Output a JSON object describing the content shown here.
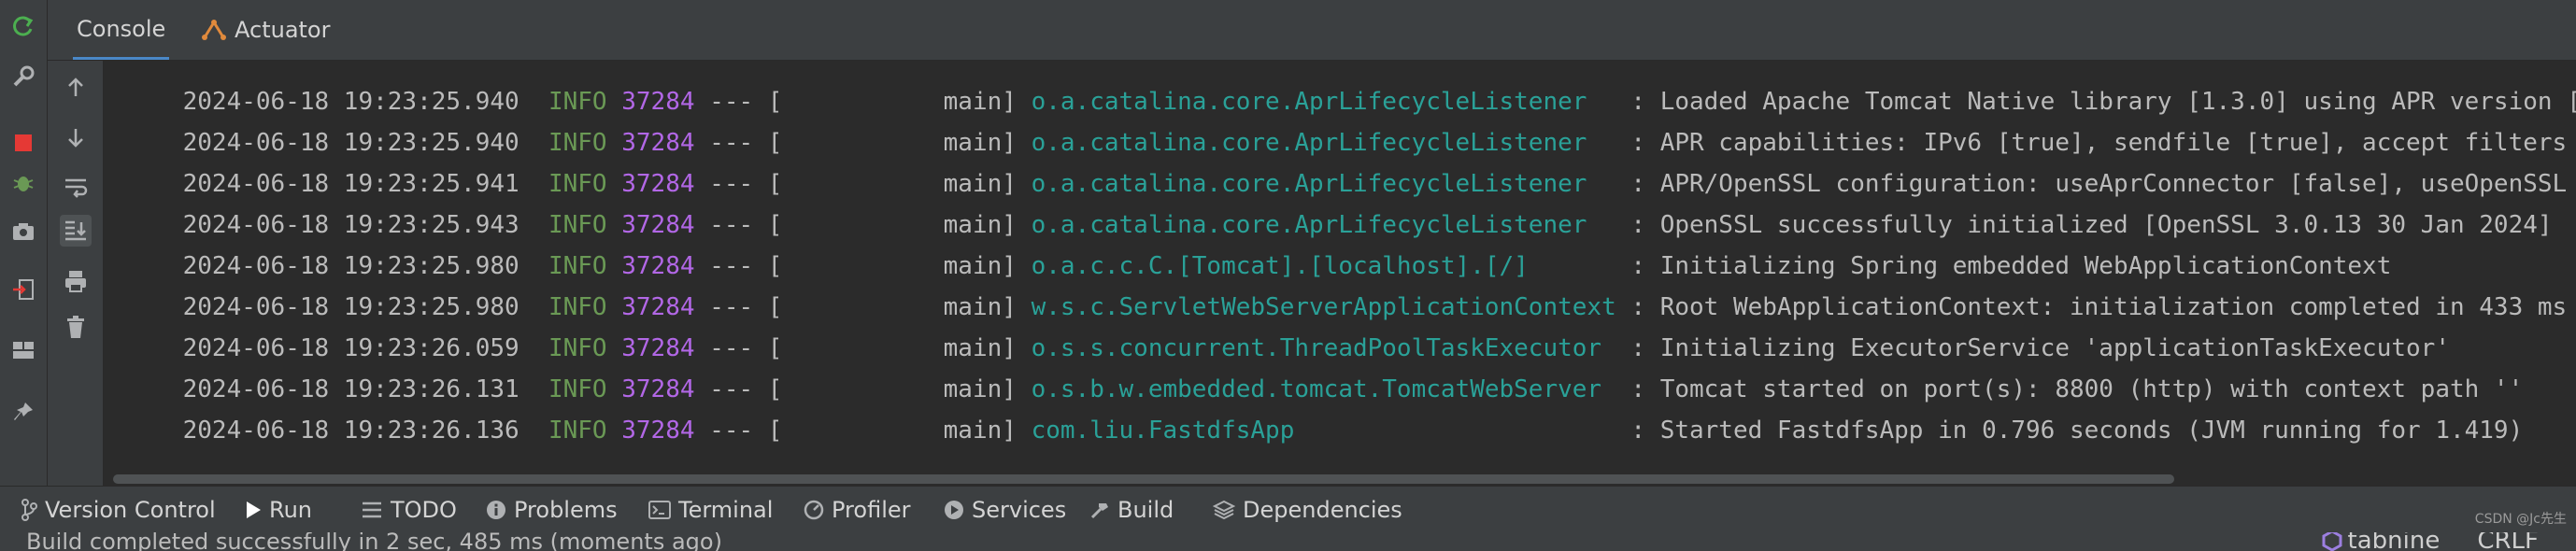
{
  "tabs": [
    {
      "label": "Console"
    },
    {
      "label": "Actuator"
    }
  ],
  "log_lines": [
    {
      "ts": "2024-06-18 19:23:25.940",
      "level": "INFO",
      "pid": "37284",
      "sep": "--- [",
      "thread": "main]",
      "logger": "o.a.catalina.core.AprLifecycleListener",
      "msg": ": Loaded Apache Tomcat Native library [1.3.0] using APR version ["
    },
    {
      "ts": "2024-06-18 19:23:25.940",
      "level": "INFO",
      "pid": "37284",
      "sep": "--- [",
      "thread": "main]",
      "logger": "o.a.catalina.core.AprLifecycleListener",
      "msg": ": APR capabilities: IPv6 [true], sendfile [true], accept filters"
    },
    {
      "ts": "2024-06-18 19:23:25.941",
      "level": "INFO",
      "pid": "37284",
      "sep": "--- [",
      "thread": "main]",
      "logger": "o.a.catalina.core.AprLifecycleListener",
      "msg": ": APR/OpenSSL configuration: useAprConnector [false], useOpenSSL"
    },
    {
      "ts": "2024-06-18 19:23:25.943",
      "level": "INFO",
      "pid": "37284",
      "sep": "--- [",
      "thread": "main]",
      "logger": "o.a.catalina.core.AprLifecycleListener",
      "msg": ": OpenSSL successfully initialized [OpenSSL 3.0.13 30 Jan 2024]"
    },
    {
      "ts": "2024-06-18 19:23:25.980",
      "level": "INFO",
      "pid": "37284",
      "sep": "--- [",
      "thread": "main]",
      "logger": "o.a.c.c.C.[Tomcat].[localhost].[/]",
      "msg": ": Initializing Spring embedded WebApplicationContext"
    },
    {
      "ts": "2024-06-18 19:23:25.980",
      "level": "INFO",
      "pid": "37284",
      "sep": "--- [",
      "thread": "main]",
      "logger": "w.s.c.ServletWebServerApplicationContext",
      "msg": ": Root WebApplicationContext: initialization completed in 433 ms"
    },
    {
      "ts": "2024-06-18 19:23:26.059",
      "level": "INFO",
      "pid": "37284",
      "sep": "--- [",
      "thread": "main]",
      "logger": "o.s.s.concurrent.ThreadPoolTaskExecutor",
      "msg": ": Initializing ExecutorService 'applicationTaskExecutor'"
    },
    {
      "ts": "2024-06-18 19:23:26.131",
      "level": "INFO",
      "pid": "37284",
      "sep": "--- [",
      "thread": "main]",
      "logger": "o.s.b.w.embedded.tomcat.TomcatWebServer",
      "msg": ": Tomcat started on port(s): 8800 (http) with context path ''"
    },
    {
      "ts": "2024-06-18 19:23:26.136",
      "level": "INFO",
      "pid": "37284",
      "sep": "--- [",
      "thread": "main]",
      "logger": "com.liu.FastdfsApp",
      "msg": ": Started FastdfsApp in 0.796 seconds (JVM running for 1.419)"
    }
  ],
  "bottom_tools": [
    {
      "label": "Version Control",
      "icon": "branch-icon"
    },
    {
      "label": "Run",
      "icon": "play-icon"
    },
    {
      "label": "TODO",
      "icon": "list-icon"
    },
    {
      "label": "Problems",
      "icon": "info-circle-icon"
    },
    {
      "label": "Terminal",
      "icon": "terminal-icon"
    },
    {
      "label": "Profiler",
      "icon": "profiler-icon"
    },
    {
      "label": "Services",
      "icon": "services-icon"
    },
    {
      "label": "Build",
      "icon": "hammer-icon"
    },
    {
      "label": "Dependencies",
      "icon": "layers-icon"
    }
  ],
  "status": {
    "text": "Build completed successfully in 2 sec, 485 ms (moments ago)"
  },
  "watermark": {
    "logo": "tabnine",
    "suffix": "CRLF",
    "small": "CSDN @Jc先生"
  },
  "colors": {
    "info": "#6a9955",
    "pid": "#b267e6",
    "logger": "#2aa198",
    "accent": "#4a88c7"
  }
}
